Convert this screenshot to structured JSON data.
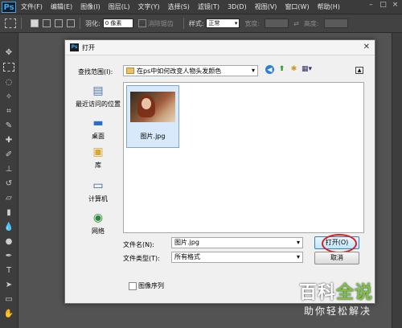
{
  "menubar": {
    "logo": "Ps",
    "items": [
      "文件(F)",
      "编辑(E)",
      "图像(I)",
      "图层(L)",
      "文字(Y)",
      "选择(S)",
      "滤镜(T)",
      "3D(D)",
      "视图(V)",
      "窗口(W)",
      "帮助(H)"
    ]
  },
  "options": {
    "feather_label": "羽化:",
    "feather_value": "0 像素",
    "antialias_label": "消除锯齿",
    "style_label": "样式:",
    "style_value": "正常",
    "width_label": "宽度:",
    "height_label": "高度:"
  },
  "dialog": {
    "title": "打开",
    "look_in_label": "查找范围(I):",
    "look_in_value": "在ps中如何改变人物头发颜色",
    "places": [
      {
        "label": "最近访问的位置",
        "icon": "recent-places-icon"
      },
      {
        "label": "桌面",
        "icon": "desktop-icon"
      },
      {
        "label": "库",
        "icon": "libraries-icon"
      },
      {
        "label": "计算机",
        "icon": "computer-icon"
      },
      {
        "label": "网络",
        "icon": "network-icon"
      }
    ],
    "files": [
      {
        "name": "图片.jpg"
      }
    ],
    "filename_label": "文件名(N):",
    "filename_value": "图片.jpg",
    "filetype_label": "文件类型(T):",
    "filetype_value": "所有格式",
    "open_button": "打开(O)",
    "cancel_button": "取消",
    "sequence_label": "图像序列"
  },
  "watermark": {
    "main_part1": "百科",
    "main_part2": "全说",
    "sub": "助你轻松解决"
  }
}
